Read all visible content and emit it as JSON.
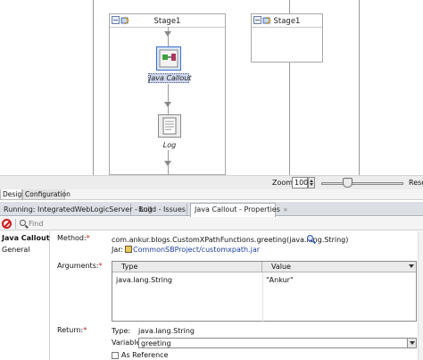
{
  "canvas": {
    "stage1_left_title": "Stage1",
    "stage1_right_title": "Stage1",
    "node_java_callout_label": "Java Callout",
    "node_log_label": "Log"
  },
  "zoom": {
    "label": "Zoom:",
    "value": "100",
    "reset_label": "Rese"
  },
  "editor_tabs": {
    "design": "Design",
    "configuration": "Configuration"
  },
  "panel_tabs": [
    {
      "label": "Running: IntegratedWebLogicServer - Log"
    },
    {
      "label": "Build - Issues"
    },
    {
      "label": "Java Callout - Properties",
      "close": "×"
    }
  ],
  "toolbar": {
    "find_placeholder": "Find"
  },
  "sidebar": {
    "items": [
      "Java Callout",
      "General"
    ]
  },
  "properties": {
    "method_label": "Method:",
    "method_value": "com.ankur.blogs.CustomXPathFunctions.greeting(java.lang.String)",
    "jar_label": "Jar:",
    "jar_value": "CommonSBProject/customxpath.jar",
    "arguments_label": "Arguments:",
    "args_columns": [
      "Type",
      "Value"
    ],
    "args_rows": [
      {
        "type": "java.lang.String",
        "value": "\"Ankur\""
      }
    ],
    "return_label": "Return:",
    "type_label": "Type:",
    "type_value": "java.lang.String",
    "variable_label": "Variable:",
    "variable_value": "greeting",
    "as_reference_label": "As Reference",
    "required_mark": "*"
  }
}
